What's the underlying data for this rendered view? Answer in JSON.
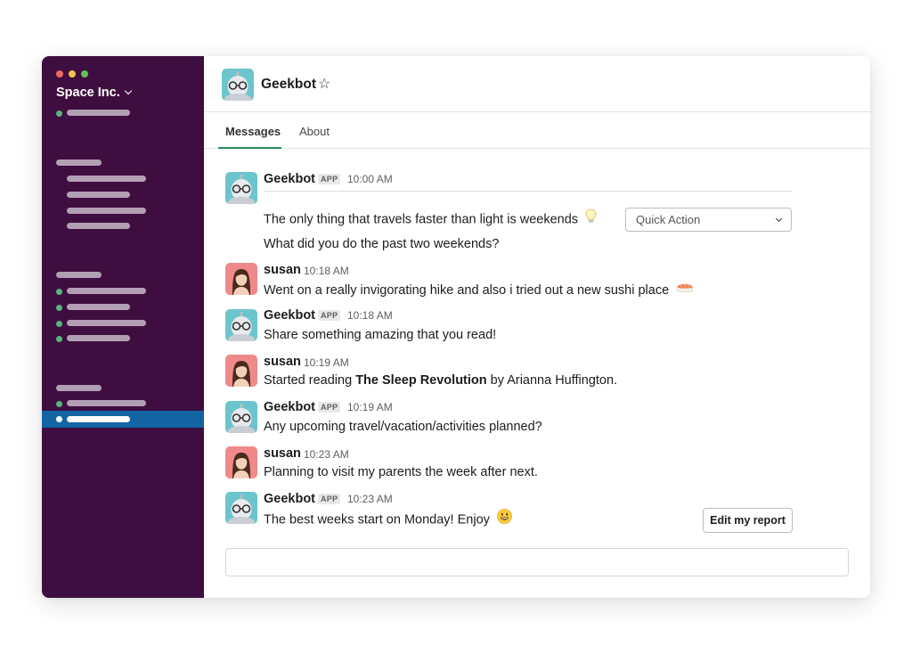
{
  "workspace": {
    "name": "Space Inc.",
    "traffic_colors": [
      "#ed6a5e",
      "#f4bf4f",
      "#61c554"
    ]
  },
  "channel": {
    "title": "Geekbot",
    "star_icon": "star-outline-icon"
  },
  "tabs": [
    {
      "label": "Messages",
      "active": true
    },
    {
      "label": "About",
      "active": false
    }
  ],
  "messages": [
    {
      "author": "Geekbot",
      "badge": "APP",
      "time": "10:00 AM",
      "lines": [
        "The only thing that travels faster than light is weekends",
        "What did you do the past two weekends?"
      ],
      "emoji": "lightbulb-icon"
    },
    {
      "author": "susan",
      "time": "10:18 AM",
      "text": "Went on a really invigorating hike and also i tried out a new sushi place",
      "emoji": "sushi-icon"
    },
    {
      "author": "Geekbot",
      "badge": "APP",
      "time": "10:18 AM",
      "text": "Share something amazing that you read!"
    },
    {
      "author": "susan",
      "time": "10:19 AM",
      "text_before": "Started reading ",
      "text_bold": "The Sleep Revolution",
      "text_after": " by Arianna Huffington."
    },
    {
      "author": "Geekbot",
      "badge": "APP",
      "time": "10:19 AM",
      "text": "Any upcoming travel/vacation/activities planned?"
    },
    {
      "author": "susan",
      "time": "10:23 AM",
      "text": "Planning to visit my parents the week after next."
    },
    {
      "author": "Geekbot",
      "badge": "APP",
      "time": "10:23 AM",
      "text": "The best weeks start on Monday! Enjoy",
      "emoji": "smiley-icon"
    }
  ],
  "quick_action": {
    "label": "Quick Action"
  },
  "edit_report": {
    "label": "Edit my report"
  },
  "colors": {
    "sidebar": "#3f0e40",
    "active_item": "#1264a3",
    "presence": "#58b57d",
    "tab_underline": "#2b8a5c"
  }
}
